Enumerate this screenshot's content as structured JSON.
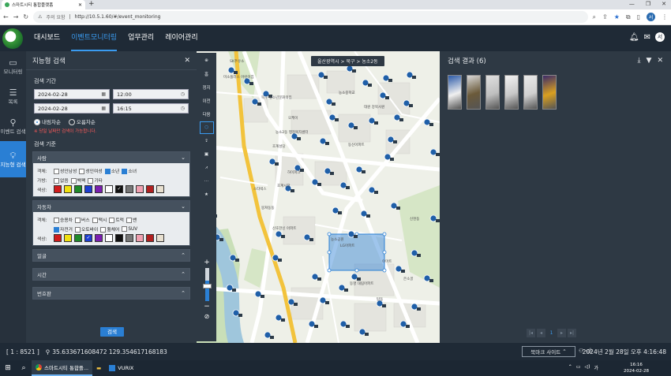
{
  "browser": {
    "tab_title": "스마트시티 통합플랫폼",
    "new_tab": "+",
    "security_label": "주의 요함",
    "url": "http://10.5.1.60/#/event_monitoring",
    "profile": "서"
  },
  "header": {
    "nav": [
      {
        "label": "대시보드",
        "active": false
      },
      {
        "label": "이벤트모니터링",
        "active": true
      },
      {
        "label": "업무관리",
        "active": false
      },
      {
        "label": "레이어관리",
        "active": false
      }
    ],
    "user_initial": "서"
  },
  "rail": {
    "items": [
      {
        "icon": "monitor-icon",
        "label": "모니터링"
      },
      {
        "icon": "list-icon",
        "label": "목록"
      },
      {
        "icon": "search-icon",
        "label": "이벤트 검색"
      },
      {
        "icon": "bulb-icon",
        "label": "지능형 검색"
      }
    ]
  },
  "search_panel": {
    "title": "지능형 검색",
    "period_label": "검색 기간",
    "start_date": "2024-02-28",
    "start_time": "12:00",
    "end_date": "2024-02-28",
    "end_time": "16:15",
    "sort_options": [
      "내림차순",
      "오름차순"
    ],
    "sort_selected": "내림차순",
    "notice": "※ 당일 날짜만 검색이 가능합니다.",
    "criteria_label": "검색 기준",
    "person": {
      "title": "사람",
      "object_label": "객체:",
      "objects": [
        {
          "label": "성인남성",
          "checked": false
        },
        {
          "label": "성인여성",
          "checked": false
        },
        {
          "label": "소년",
          "checked": true
        },
        {
          "label": "소녀",
          "checked": true
        }
      ],
      "carry_label": "가방:",
      "carry": [
        {
          "label": "없음",
          "checked": false
        },
        {
          "label": "백팩",
          "checked": false
        },
        {
          "label": "기타",
          "checked": false
        }
      ],
      "color_label": "색상:",
      "colors": [
        "#d01c1c",
        "#f0e010",
        "#1f8a2a",
        "#1d3fd1",
        "#7a1fb0",
        "#ffffff",
        "#111111",
        "#777777",
        "#f0a0b0",
        "#b02020",
        "#e8e0d0"
      ]
    },
    "vehicle": {
      "title": "자동차",
      "object_label": "객체:",
      "row1": [
        {
          "label": "승용차",
          "checked": false
        },
        {
          "label": "버스",
          "checked": false
        },
        {
          "label": "택시",
          "checked": false
        },
        {
          "label": "트럭",
          "checked": false
        },
        {
          "label": "밴",
          "checked": false
        }
      ],
      "row2": [
        {
          "label": "자전거",
          "checked": true
        },
        {
          "label": "오토바이",
          "checked": false
        },
        {
          "label": "휠체어",
          "checked": false
        },
        {
          "label": "SUV",
          "checked": false
        }
      ],
      "color_label": "색상:",
      "colors": [
        "#d01c1c",
        "#f0e010",
        "#1f8a2a",
        "#1d3fd1",
        "#7a1fb0",
        "#ffffff",
        "#111111",
        "#777777",
        "#f0a0b0",
        "#b02020",
        "#e8e0d0"
      ]
    },
    "collapsed": [
      "얼굴",
      "시간",
      "번호판"
    ],
    "search_button": "검색"
  },
  "map": {
    "breadcrumb": "울산광역시 > 북구 > 농소2동",
    "tools": [
      "홈",
      "정지",
      "이전",
      "다음"
    ],
    "labels": [
      "SK주유소",
      "미소플러스 어린이집",
      "농소중학교",
      "북구 청소년문화의집",
      "오케이",
      "대원 강북사원",
      "동신아파트",
      "농소2동 행정복지센터",
      "호계성당",
      "하이파크",
      "스타벅스",
      "호계시장",
      "뭉쳐둥둥",
      "산호한신 아파트",
      "농소공원",
      "LG아파트",
      "동명 대림아파트",
      "탑동",
      "이마트",
      "은소골",
      "신천동"
    ]
  },
  "results": {
    "title": "검색 결과 (6)",
    "count": 6,
    "page": "1"
  },
  "status": {
    "level": "[ 1 : 8521 ]",
    "coords": "35.633671608472 129.354617168183",
    "bookmark": "북마크 사이트",
    "datetime": "2024년 2월 28일 오후 4:16:48"
  },
  "taskbar": {
    "apps": [
      "스마트시티 통합플...",
      "VURIX"
    ],
    "time": "16:16",
    "date": "2024-02-28"
  }
}
